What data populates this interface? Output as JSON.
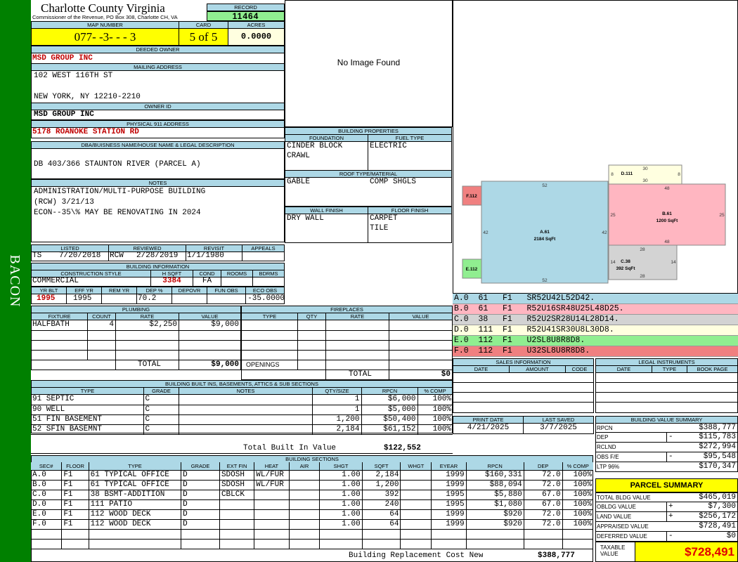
{
  "side_label": "BACON",
  "header": {
    "county": "Charlotte County Virginia",
    "commissioner": "Commissioner of the Revenue, PO Box 308, Charlotte CH, VA",
    "record_label": "RECORD",
    "record": "11464"
  },
  "map": {
    "map_label": "MAP NUMBER",
    "map_number": "077- -3- - - 3",
    "card_label": "CARD",
    "card": "5 of 5",
    "acres_label": "ACRES",
    "acres": "0.0000"
  },
  "owner": {
    "deeded_label": "DEEDED OWNER",
    "deeded": "MSD GROUP INC",
    "mailing_label": "MAILING ADDRESS",
    "mail1": "102 WEST 116TH ST",
    "mail2": "NEW YORK, NY 12210-2210",
    "ownerid_label": "OWNER ID",
    "ownerid": "MSD GROUP INC",
    "phys_label": "PHYSICAL 911 ADDRESS",
    "phys": "5178 ROANOKE STATION RD"
  },
  "dba": {
    "label": "DBA/BUISNESS NAME/HOUSE NAME & LEGAL DESCRIPTION",
    "text": "DB 403/366 STAUNTON RIVER (PARCEL A)"
  },
  "notes": {
    "label": "NOTES",
    "l1": "ADMINISTRATION/MULTI-PURPOSE BUILDING",
    "l2": "(RCW) 3/21/13",
    "l3": "ECON--35\\% MAY BE RENOVATING IN 2024"
  },
  "image": {
    "none": "No Image Found"
  },
  "props": {
    "title": "BUILDING PROPERTIES",
    "foundation_label": "FOUNDATION",
    "fuel_label": "FUEL TYPE",
    "found1": "CINDER BLOCK",
    "found2": "CRAWL",
    "fuel": "ELECTRIC",
    "roof_label": "ROOF TYPE/MATERIAL",
    "roof1": "GABLE",
    "roof2": "COMP SHGLS",
    "wall_label": "WALL FINISH",
    "floor_label": "FLOOR FINISH",
    "wall": "DRY WALL",
    "floor1": "CARPET",
    "floor2": "TILE"
  },
  "dates": {
    "listed_label": "LISTED",
    "reviewed_label": "REVIEWED",
    "revisit_label": "REVISIT",
    "appeals_label": "APPEALS",
    "listed_by": "TS",
    "listed": "7/20/2018",
    "reviewed_by": "RCW",
    "reviewed": "2/28/2019",
    "revisit": "1/1/1980"
  },
  "binfo": {
    "title": "BUILDING INFORMATION",
    "style_label": "CONSTRUCTION STYLE",
    "hsqft_label": "H SQFT",
    "cond_label": "COND",
    "rooms_label": "ROOMS",
    "bdrms_label": "BDRMS",
    "style": "COMMERCIAL",
    "hsqft": "3384",
    "cond": "FA",
    "yrblt_label": "YR BLT",
    "effyr_label": "EFF YR",
    "remyr_label": "REM YR",
    "dep_label": "DEP %",
    "depovr_label": "DEPOVR",
    "funobs_label": "FUN OBS",
    "ecoobs_label": "ECO OBS",
    "yrblt": "1995",
    "effyr": "1995",
    "dep": "70.2",
    "ecoobs": "-35.0000"
  },
  "plumbing": {
    "title": "PLUMBING",
    "cols": [
      "FIXTURE",
      "COUNT",
      "RATE",
      "VALUE"
    ],
    "rows": [
      [
        "HALFBATH",
        "4",
        "$2,250",
        "$9,000"
      ]
    ],
    "total_label": "TOTAL",
    "total": "$9,000"
  },
  "fireplaces": {
    "title": "FIREPLACES",
    "cols": [
      "TYPE",
      "QTY",
      "RATE",
      "VALUE"
    ],
    "openings_label": "OPENINGS",
    "total_label": "TOTAL",
    "total": "$0"
  },
  "builtins": {
    "title": "BUILDING BUILT INS, BASEMENTS, ATTICS & SUB SECTIONS",
    "cols": [
      "TYPE",
      "GRADE",
      "NOTES",
      "QTY/SIZE",
      "RPCN",
      "% COMP"
    ],
    "rows": [
      [
        "91 SEPTIC",
        "C",
        "",
        "1",
        "$6,000",
        "100%"
      ],
      [
        "90 WELL",
        "C",
        "",
        "1",
        "$5,000",
        "100%"
      ],
      [
        "51 FIN BASEMENT",
        "C",
        "",
        "1,200",
        "$50,400",
        "100%"
      ],
      [
        "52 SFIN BASEMNT",
        "C",
        "",
        "2,184",
        "$61,152",
        "100%"
      ]
    ],
    "total_label": "Total Built In Value",
    "total": "$122,552"
  },
  "sections": {
    "title": "BUILDING SECTIONS",
    "cols": [
      "SEC#",
      "FLOOR",
      "TYPE",
      "GRADE",
      "EXT FIN",
      "HEAT",
      "AIR",
      "SHGT",
      "SQFT",
      "WHGT",
      "EYEAR",
      "RPCN",
      "DEP",
      "% COMP"
    ],
    "rows": [
      [
        "A.0",
        "F1",
        "61 TYPICAL OFFICE",
        "D",
        "SDOSH",
        "WL/FUR",
        "",
        "1.00",
        "2,184",
        "",
        "1999",
        "$160,331",
        "72.0",
        "100%"
      ],
      [
        "B.0",
        "F1",
        "61 TYPICAL OFFICE",
        "D",
        "SDOSH",
        "WL/FUR",
        "",
        "1.00",
        "1,200",
        "",
        "1999",
        "$88,094",
        "72.0",
        "100%"
      ],
      [
        "C.0",
        "F1",
        "38 BSMT-ADDITION",
        "D",
        "CBLCK",
        "",
        "",
        "1.00",
        "392",
        "",
        "1995",
        "$5,880",
        "67.0",
        "100%"
      ],
      [
        "D.0",
        "F1",
        "111 PATIO",
        "D",
        "",
        "",
        "",
        "1.00",
        "240",
        "",
        "1995",
        "$1,080",
        "67.0",
        "100%"
      ],
      [
        "E.0",
        "F1",
        "112 WOOD DECK",
        "D",
        "",
        "",
        "",
        "1.00",
        "64",
        "",
        "1999",
        "$920",
        "72.0",
        "100%"
      ],
      [
        "F.0",
        "F1",
        "112 WOOD DECK",
        "D",
        "",
        "",
        "",
        "1.00",
        "64",
        "",
        "1999",
        "$920",
        "72.0",
        "100%"
      ]
    ],
    "replacement_label": "Building Replacement Cost New",
    "replacement": "$388,777"
  },
  "sketch": {
    "a_label": "A.61",
    "a_area": "2184 SqFt",
    "b_label": "B.61",
    "b_area": "1200 SqFt",
    "c_label": "C.38",
    "c_area": "392 SqFt",
    "d_label": "D.111",
    "e_label": "E.112",
    "f_label": "F.112",
    "dims": {
      "a_top": "52",
      "a_bot": "52",
      "a_left": "42",
      "a_right": "42",
      "b_top": "48",
      "b_bot": "48",
      "b_left": "25",
      "b_right": "25",
      "c_top": "28",
      "c_bot": "28",
      "c_left": "14",
      "c_right": "14",
      "d_top": "30",
      "d_bot": "30",
      "d_left": "8",
      "d_right": "8"
    }
  },
  "legend": [
    {
      "text": "A.0  61   F1   SR52U42L52D42.",
      "color": "#add8e6"
    },
    {
      "text": "B.0  61   F1   R52U16SR48U25L48D25.",
      "color": "#ffb6c1"
    },
    {
      "text": "C.0  38   F1   R52U2SR28U14L28D14.",
      "color": "#d3d3d3"
    },
    {
      "text": "D.0  111  F1   R52U41SR30U8L30D8.",
      "color": "#ffffe0"
    },
    {
      "text": "E.0  112  F1   U2SL8U8R8D8.",
      "color": "#90ee90"
    },
    {
      "text": "F.0  112  F1   U32SL8U8R8D8.",
      "color": "#f08080"
    }
  ],
  "sales": {
    "title": "SALES INFORMATION",
    "cols": [
      "DATE",
      "AMOUNT",
      "CODE"
    ]
  },
  "legal": {
    "title": "LEGAL INSTRUMENTS",
    "cols": [
      "DATE",
      "TYPE",
      "BOOK PAGE"
    ]
  },
  "print": {
    "print_label": "PRINT DATE",
    "saved_label": "LAST SAVED",
    "print": "4/21/2025",
    "saved": "3/7/2025"
  },
  "bvs": {
    "title": "BUILDING VALUE SUMMARY",
    "rows": [
      [
        "RPCN",
        "",
        "$388,777"
      ],
      [
        "DEP",
        "-",
        "$115,783"
      ],
      [
        "RCLND",
        "",
        "$272,994"
      ],
      [
        "OBS F/E",
        "-",
        "$95,548"
      ],
      [
        "LTP 96%",
        "",
        "$170,347"
      ]
    ]
  },
  "parcel": {
    "title": "PARCEL SUMMARY",
    "rows": [
      [
        "TOTAL BLDG VALUE",
        "",
        "$465,019"
      ],
      [
        "OBLDG VALUE",
        "+",
        "$7,300"
      ],
      [
        "LAND VALUE",
        "+",
        "$256,172"
      ],
      [
        "APPRAISED VALUE",
        "",
        "$728,491"
      ],
      [
        "DEFERRED VALUE",
        "-",
        "$0"
      ]
    ],
    "taxable_label": "TAXABLE VALUE",
    "taxable": "$728,491"
  }
}
